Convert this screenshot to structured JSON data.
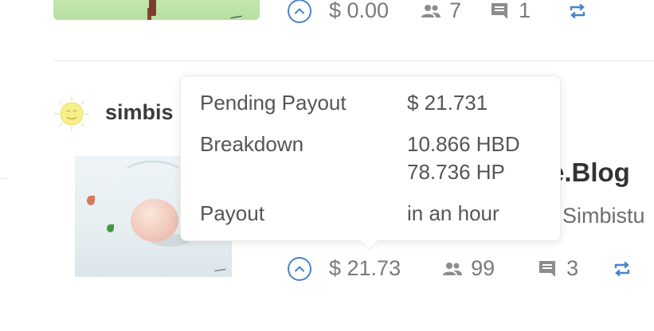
{
  "top_post": {
    "payout": "$ 0.00",
    "voters": "7",
    "comments": "1"
  },
  "post": {
    "author": "simbis",
    "title_partial": "e.Blog",
    "subtitle_partial": "Simbistu",
    "payout": "$ 21.73",
    "voters": "99",
    "comments": "3"
  },
  "tooltip": {
    "rows": [
      {
        "label": "Pending Payout",
        "value": "$ 21.731"
      },
      {
        "label": "Breakdown",
        "value": "10.866 HBD",
        "value2": "78.736 HP"
      },
      {
        "label": "Payout",
        "value": "in an hour"
      }
    ]
  },
  "colors": {
    "accent": "#4a83cc",
    "meta_text": "#7a7a7a",
    "icon_gray": "#8c8c8c"
  },
  "icons": [
    "chevron-up-icon",
    "people-icon",
    "comment-icon",
    "reblog-icon"
  ]
}
